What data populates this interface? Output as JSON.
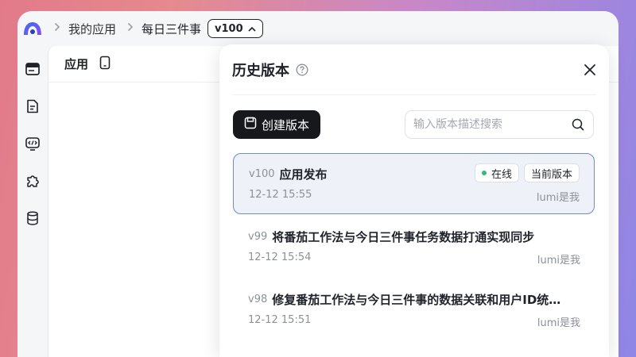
{
  "breadcrumb": {
    "items": [
      "我的应用",
      "每日三件事"
    ],
    "version_badge": "v100"
  },
  "main": {
    "tab_title": "应用"
  },
  "history_panel": {
    "title": "历史版本",
    "create_button": "创建版本",
    "search_placeholder": "输入版本描述搜索",
    "versions": [
      {
        "version": "v100",
        "title": "应用发布",
        "time": "12-12 15:55",
        "author": "lumi是我",
        "status": "在线",
        "current_label": "当前版本"
      },
      {
        "version": "v99",
        "title": "将番茄工作法与今日三件事任务数据打通实现同步",
        "time": "12-12 15:54",
        "author": "lumi是我"
      },
      {
        "version": "v98",
        "title": "修复番茄工作法与今日三件事的数据关联和用户ID统…",
        "time": "12-12 15:51",
        "author": "lumi是我"
      }
    ]
  },
  "colors": {
    "accent_border": "#6f8ad6",
    "online_dot": "#2fbf71",
    "dark_button": "#16181c"
  }
}
